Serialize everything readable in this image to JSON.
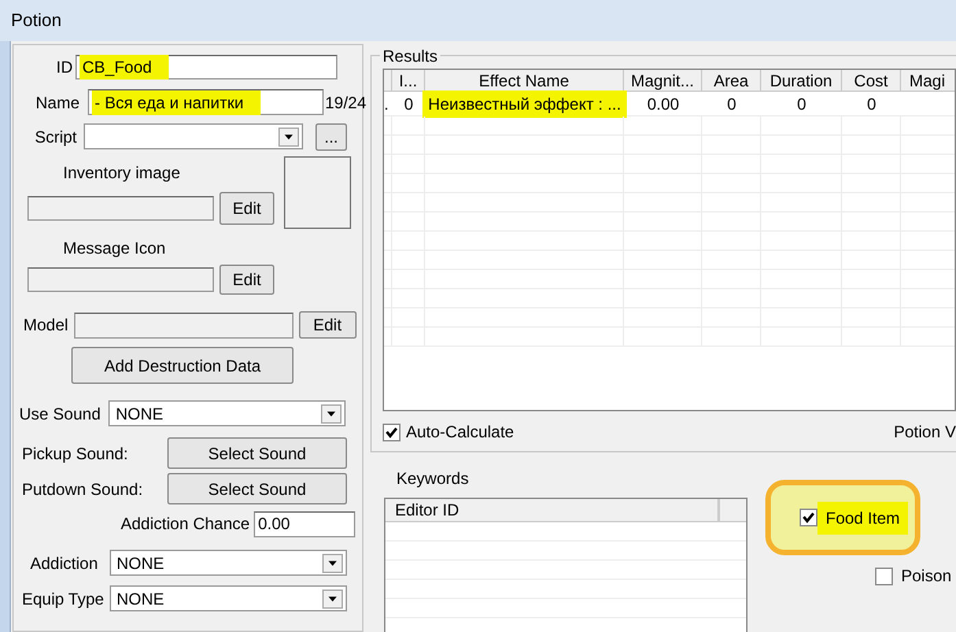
{
  "window": {
    "title": "Potion"
  },
  "id_field": {
    "label": "ID",
    "value": "CB_Food",
    "highlighted": true
  },
  "name_field": {
    "label": "Name",
    "value": "- Вся еда и напитки",
    "highlighted": true,
    "counter": "19/24"
  },
  "script": {
    "label": "Script",
    "browse_button": "..."
  },
  "inventory_image": {
    "label": "Inventory image",
    "button": "Edit"
  },
  "message_icon": {
    "label": "Message Icon",
    "button": "Edit"
  },
  "model": {
    "label": "Model",
    "button": "Edit"
  },
  "destruction_button": "Add Destruction Data",
  "use_sound": {
    "label": "Use Sound",
    "value": "NONE"
  },
  "pickup_sound": {
    "label": "Pickup Sound:",
    "button": "Select Sound"
  },
  "putdown_sound": {
    "label": "Putdown Sound:",
    "button": "Select Sound"
  },
  "addiction_chance": {
    "label": "Addiction Chance",
    "value": "0.00"
  },
  "addiction": {
    "label": "Addiction",
    "value": "NONE"
  },
  "equip_type": {
    "label": "Equip Type",
    "value": "NONE"
  },
  "results": {
    "title": "Results",
    "columns": [
      "I...",
      "Effect Name",
      "Magnit...",
      "Area",
      "Duration",
      "Cost",
      "Magi"
    ],
    "rows": [
      {
        "indicator": ".",
        "cells": [
          {
            "text": "0",
            "highlighted": false
          },
          {
            "text": "Неизвестный эффект : ...",
            "highlighted": true
          },
          {
            "text": "0.00",
            "highlighted": false
          },
          {
            "text": "0",
            "highlighted": false
          },
          {
            "text": "0",
            "highlighted": false
          },
          {
            "text": "0",
            "highlighted": false
          }
        ]
      }
    ]
  },
  "auto_calculate": {
    "label": "Auto-Calculate",
    "checked": true
  },
  "potion_value_label": "Potion V",
  "keywords": {
    "title": "Keywords",
    "columns": [
      "Editor ID"
    ]
  },
  "flags": [
    {
      "label": "Food Item",
      "checked": true,
      "highlighted": true
    },
    {
      "label": "Poison",
      "checked": false,
      "highlighted": false
    }
  ]
}
